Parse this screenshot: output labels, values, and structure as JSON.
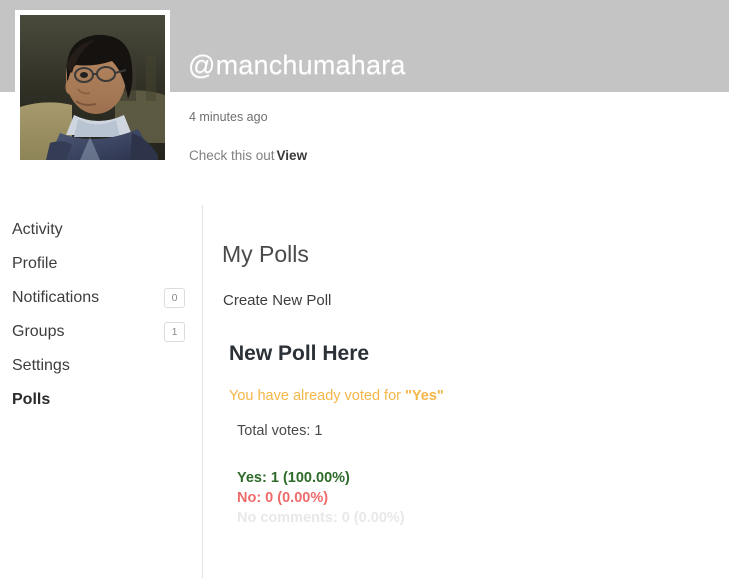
{
  "header": {
    "handle": "@manchumahara",
    "timestamp": "4 minutes ago",
    "activity_text": "Check this out",
    "view_label": "View",
    "avatar_alt": "user-avatar-photo",
    "banner_color": "#c4c4c4"
  },
  "sidebar": {
    "items": [
      {
        "label": "Activity",
        "badge": null,
        "active": false
      },
      {
        "label": "Profile",
        "badge": null,
        "active": false
      },
      {
        "label": "Notifications",
        "badge": "0",
        "active": false
      },
      {
        "label": "Groups",
        "badge": "1",
        "active": false
      },
      {
        "label": "Settings",
        "badge": null,
        "active": false
      },
      {
        "label": "Polls",
        "badge": null,
        "active": true
      }
    ]
  },
  "main": {
    "title": "My Polls",
    "create_link": "Create New Poll",
    "poll": {
      "title": "New Poll Here",
      "voted_prefix": "You have already voted for ",
      "voted_choice": "\"Yes\"",
      "total_votes_label": "Total votes: 1",
      "results": [
        {
          "label": "Yes: 1 (100.00%)",
          "option": "Yes",
          "votes": 1,
          "percent": "100.00%",
          "color": "#2d6b2a"
        },
        {
          "label": "No: 0 (0.00%)",
          "option": "No",
          "votes": 0,
          "percent": "0.00%",
          "color": "#ef6b6b"
        },
        {
          "label": "No comments: 0 (0.00%)",
          "option": "No comments",
          "votes": 0,
          "percent": "0.00%",
          "color": "#e8e8e8"
        }
      ]
    }
  }
}
